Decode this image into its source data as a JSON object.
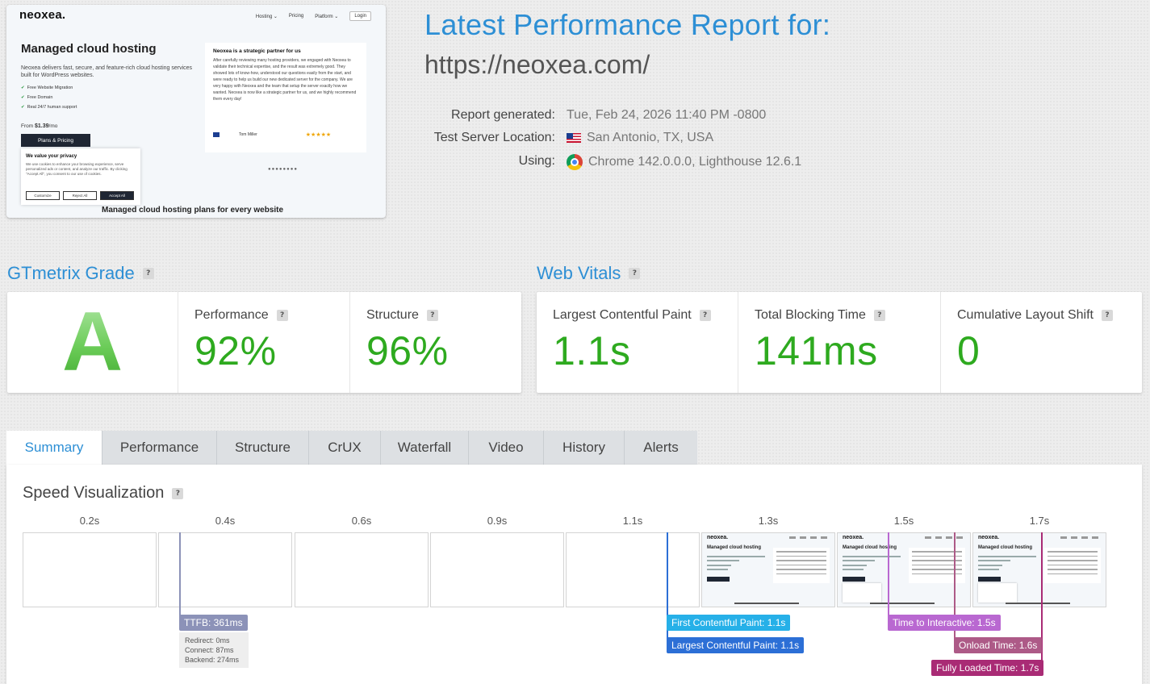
{
  "thumbnail": {
    "logo": "neoxea.",
    "nav": [
      "Hosting ⌄",
      "Pricing",
      "Platform ⌄",
      "Login"
    ],
    "hero_title": "Managed cloud hosting",
    "hero_desc": "Neoxea delivers fast, secure, and feature-rich cloud hosting services built for WordPress websites.",
    "features": [
      "Free Website Migration",
      "Free Domain",
      "Real 24/7 human support"
    ],
    "price_prefix": "From ",
    "price": "$1.39",
    "price_suffix": "/mo",
    "plans_button": "Plans & Pricing",
    "cookie_title": "We value your privacy",
    "cookie_text": "We use cookies to enhance your browsing experience, serve personalized ads or content, and analyze our traffic. By clicking \"Accept All\", you consent to our use of cookies.",
    "cookie_buttons": [
      "Customize",
      "Reject All",
      "Accept All"
    ],
    "testimonial_title": "Neoxea is a strategic partner for us",
    "testimonial_text": "After carefully reviewing many hosting providers, we engaged with Neoxea to validate their technical expertise, and the result was extremely good. They showed lots of know-how, understood our questions easily from the start, and were ready to help us build our new dedicated server for the company. We are very happy with Neoxea and the team that setup the server exactly how we wanted. Neoxea is now like a strategic partner for us, and we highly recommend them every day!",
    "testimonial_author": "Tom Miller",
    "stars": "★★★★★",
    "carousel_dots": "●●●●●●●●",
    "plans_title": "Managed cloud hosting plans for every website"
  },
  "report": {
    "title": "Latest Performance Report for:",
    "url": "https://neoxea.com/",
    "generated_label": "Report generated:",
    "generated_value": "Tue, Feb 24, 2026 11:40 PM -0800",
    "location_label": "Test Server Location:",
    "location_value": "San Antonio, TX, USA",
    "using_label": "Using:",
    "using_value": "Chrome 142.0.0.0, Lighthouse 12.6.1"
  },
  "grade": {
    "title": "GTmetrix Grade",
    "letter": "A",
    "performance_label": "Performance",
    "performance_value": "92%",
    "structure_label": "Structure",
    "structure_value": "96%"
  },
  "vitals": {
    "title": "Web Vitals",
    "lcp_label": "Largest Contentful Paint",
    "lcp_value": "1.1s",
    "tbt_label": "Total Blocking Time",
    "tbt_value": "141ms",
    "cls_label": "Cumulative Layout Shift",
    "cls_value": "0"
  },
  "help_mark": "?",
  "tabs": [
    "Summary",
    "Performance",
    "Structure",
    "CrUX",
    "Waterfall",
    "Video",
    "History",
    "Alerts"
  ],
  "speed": {
    "title": "Speed Visualization",
    "frames": [
      "0.2s",
      "0.4s",
      "0.6s",
      "0.9s",
      "1.1s",
      "1.3s",
      "1.5s",
      "1.7s"
    ],
    "frame_logo": "neoxea.",
    "frame_heading": "Managed cloud hosting",
    "markers": {
      "ttfb": "TTFB: 361ms",
      "redirect": "Redirect: 0ms",
      "connect": "Connect: 87ms",
      "backend": "Backend: 274ms",
      "fcp": "First Contentful Paint: 1.1s",
      "lcp": "Largest Contentful Paint: 1.1s",
      "tti": "Time to Interactive: 1.5s",
      "onload": "Onload Time: 1.6s",
      "fully_loaded": "Fully Loaded Time: 1.7s"
    }
  },
  "colors": {
    "accent": "#2d8fd5",
    "good": "#2eaa1f",
    "ttfb": "#8c92b8",
    "fcp": "#26b0e8",
    "lcp": "#2c6fd6",
    "tti": "#b968d1",
    "onload": "#ad5a87",
    "fully_loaded": "#a92b75"
  }
}
